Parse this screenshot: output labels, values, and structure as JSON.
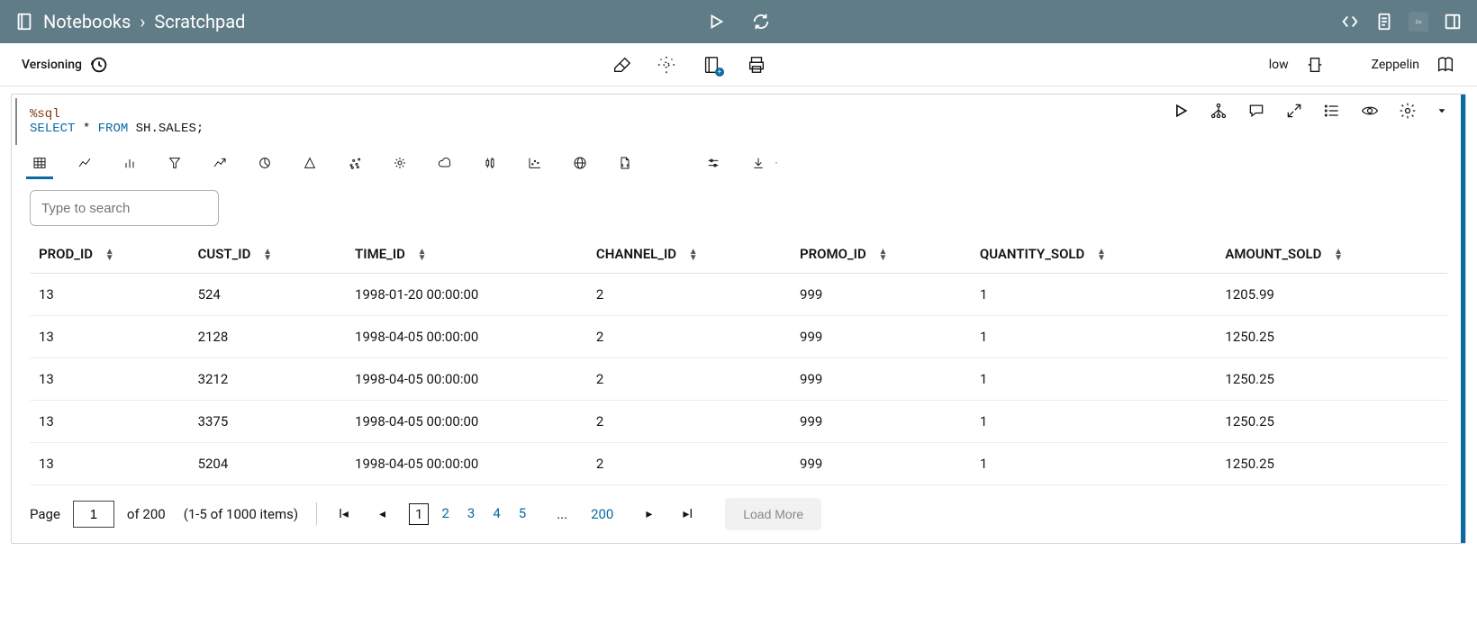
{
  "header": {
    "breadcrumb_root": "Notebooks",
    "breadcrumb_current": "Scratchpad"
  },
  "toolbar": {
    "versioning_label": "Versioning",
    "paragraph_width_label": "low",
    "notebook_type_label": "Zeppelin"
  },
  "code": {
    "magic": "%sql",
    "statement": "SELECT * FROM SH.SALES;"
  },
  "search": {
    "placeholder": "Type to search"
  },
  "table": {
    "columns": [
      "PROD_ID",
      "CUST_ID",
      "TIME_ID",
      "CHANNEL_ID",
      "PROMO_ID",
      "QUANTITY_SOLD",
      "AMOUNT_SOLD"
    ],
    "rows": [
      [
        "13",
        "524",
        "1998-01-20 00:00:00",
        "2",
        "999",
        "1",
        "1205.99"
      ],
      [
        "13",
        "2128",
        "1998-04-05 00:00:00",
        "2",
        "999",
        "1",
        "1250.25"
      ],
      [
        "13",
        "3212",
        "1998-04-05 00:00:00",
        "2",
        "999",
        "1",
        "1250.25"
      ],
      [
        "13",
        "3375",
        "1998-04-05 00:00:00",
        "2",
        "999",
        "1",
        "1250.25"
      ],
      [
        "13",
        "5204",
        "1998-04-05 00:00:00",
        "2",
        "999",
        "1",
        "1250.25"
      ]
    ]
  },
  "pager": {
    "page_label": "Page",
    "current_page": "1",
    "of_label": "of 200",
    "range_label": "(1-5 of 1000 items)",
    "pages": [
      "1",
      "2",
      "3",
      "4",
      "5"
    ],
    "ellipsis": "...",
    "last_page": "200",
    "load_more_label": "Load More"
  }
}
